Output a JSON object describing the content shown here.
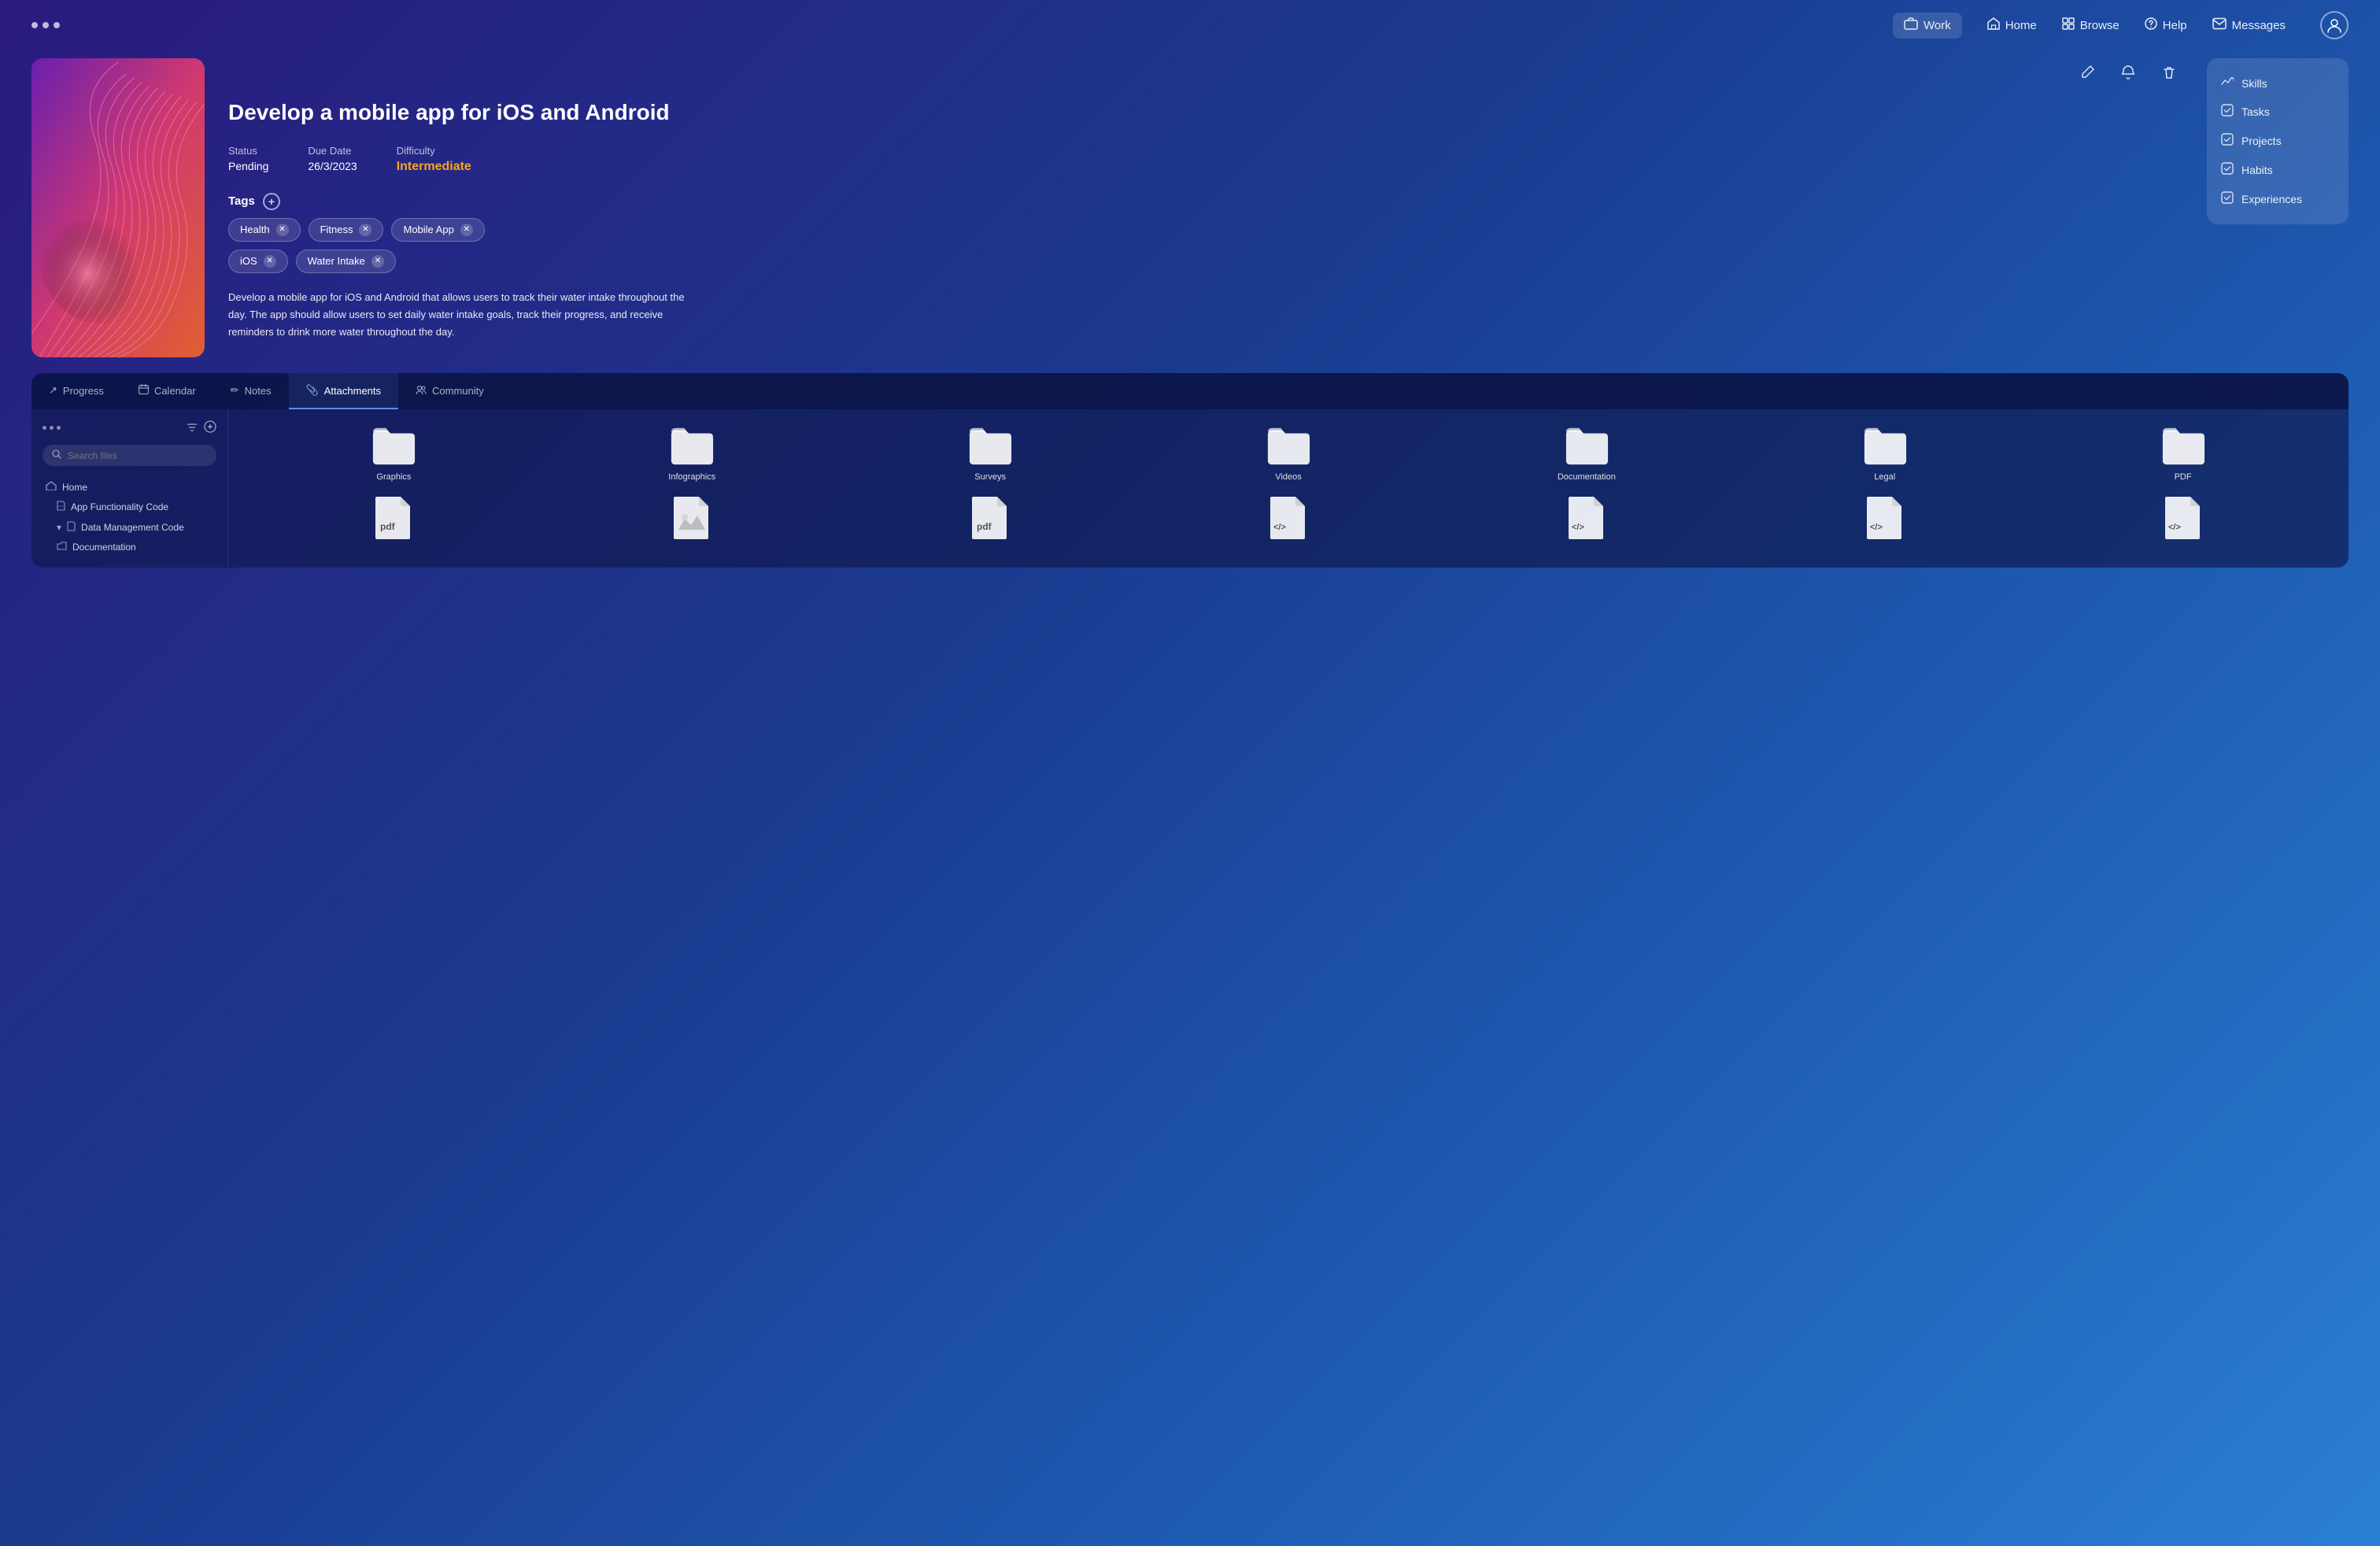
{
  "nav": {
    "dots_count": 3,
    "links": [
      {
        "label": "Work",
        "icon": "🗂",
        "active": true
      },
      {
        "label": "Home",
        "icon": "🏠",
        "active": false
      },
      {
        "label": "Browse",
        "icon": "⊞",
        "active": false
      },
      {
        "label": "Help",
        "icon": "?",
        "active": false
      },
      {
        "label": "Messages",
        "icon": "✉",
        "active": false
      }
    ]
  },
  "task": {
    "title": "Develop a mobile app for iOS and Android",
    "status_label": "Status",
    "status_value": "Pending",
    "due_date_label": "Due Date",
    "due_date_value": "26/3/2023",
    "difficulty_label": "Difficulty",
    "difficulty_value": "Intermediate",
    "tags_label": "Tags",
    "tags": [
      "Health",
      "Fitness",
      "Mobile App",
      "iOS",
      "Water Intake"
    ],
    "description": "Develop a mobile app for iOS and Android that allows users to track their water intake throughout the day. The app should allow users to set daily water intake goals, track their progress, and receive reminders to drink more water throughout the day."
  },
  "right_menu": {
    "items": [
      "Skills",
      "Tasks",
      "Projects",
      "Habits",
      "Experiences"
    ]
  },
  "bottom_panel": {
    "tabs": [
      {
        "label": "Progress",
        "icon": "↗",
        "active": false
      },
      {
        "label": "Calendar",
        "icon": "📅",
        "active": false
      },
      {
        "label": "Notes",
        "icon": "✏",
        "active": false
      },
      {
        "label": "Attachments",
        "icon": "📎",
        "active": true
      },
      {
        "label": "Community",
        "icon": "👥",
        "active": false
      }
    ],
    "search_placeholder": "Search files",
    "file_tree": [
      {
        "label": "Home",
        "icon": "🏠",
        "indent": 0
      },
      {
        "label": "App Functionality Code",
        "icon": "📄",
        "indent": 1
      },
      {
        "label": "Data Management Code",
        "icon": "📄",
        "indent": 1,
        "expanded": true
      },
      {
        "label": "Documentation",
        "icon": "📁",
        "indent": 1
      }
    ],
    "folders": [
      {
        "label": "Graphics",
        "type": "folder"
      },
      {
        "label": "Infographics",
        "type": "folder"
      },
      {
        "label": "Surveys",
        "type": "folder"
      },
      {
        "label": "Videos",
        "type": "folder"
      },
      {
        "label": "Documentation",
        "type": "folder"
      },
      {
        "label": "Legal",
        "type": "folder"
      },
      {
        "label": "PDF",
        "type": "folder"
      }
    ],
    "files_row2": [
      {
        "label": "",
        "type": "pdf"
      },
      {
        "label": "",
        "type": "image"
      },
      {
        "label": "",
        "type": "pdf"
      },
      {
        "label": "",
        "type": "code"
      },
      {
        "label": "",
        "type": "code"
      },
      {
        "label": "",
        "type": "code"
      },
      {
        "label": "",
        "type": "code"
      }
    ]
  }
}
